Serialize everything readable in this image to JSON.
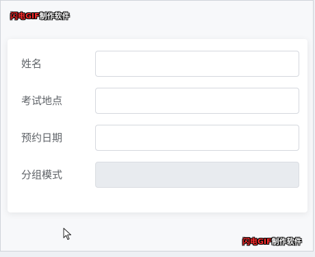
{
  "watermark": {
    "brand": "闪电GIF",
    "rest": "制作软件"
  },
  "form": {
    "fields": [
      {
        "label": "姓名",
        "value": "",
        "placeholder": ""
      },
      {
        "label": "考试地点",
        "value": "",
        "placeholder": ""
      },
      {
        "label": "预约日期",
        "value": "",
        "placeholder": ""
      },
      {
        "label": "分组模式",
        "value": "",
        "placeholder": "",
        "disabled": true
      }
    ]
  },
  "icons": {
    "cursor": "mouse-pointer-icon"
  },
  "colors": {
    "label": "#5f6368",
    "input_border": "#d4d7dd",
    "disabled_bg": "#e8ebef",
    "watermark_brand": "#ff2d2d"
  }
}
